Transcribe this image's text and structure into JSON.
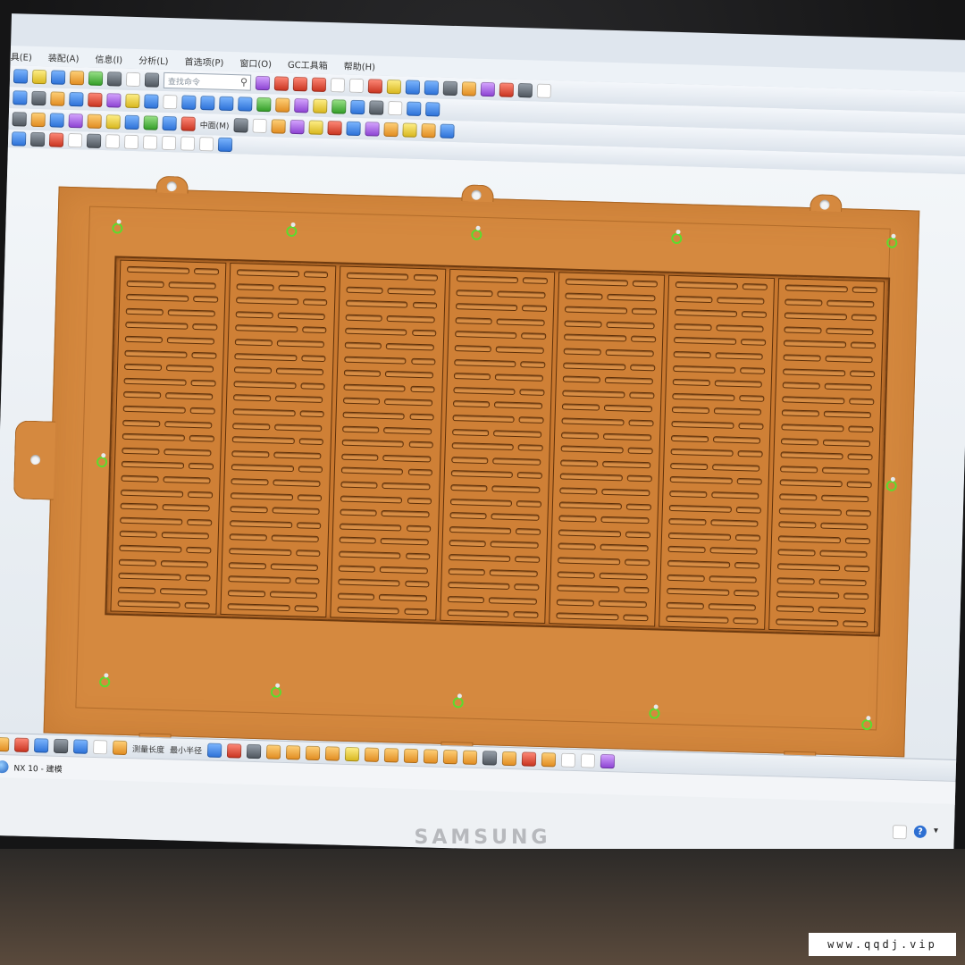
{
  "app": {
    "menu": [
      "具(E)",
      "装配(A)",
      "信息(I)",
      "分析(L)",
      "首选项(P)",
      "窗口(O)",
      "GC工具箱",
      "帮助(H)"
    ],
    "search_placeholder": "查找命令",
    "toolbar_labels": [
      "中面(M)"
    ],
    "bottom_toolbar_labels": [
      "测量长度",
      "最小半径"
    ],
    "status_task": "NX 10 - 建模",
    "monitor_brand": "SAMSUNG",
    "watermark": "www.qqdj.vip"
  },
  "colors": {
    "part_orange": "#d5893f",
    "part_edge": "#a96523",
    "viewport_bg": "#e9eef3",
    "marker_green": "#5bdc2e",
    "accent_blue": "#2d6fd2"
  },
  "icons": {
    "search": "search-icon",
    "help": "help-icon",
    "refresh": "refresh-icon",
    "clock": "clock-icon",
    "globe": "globe-icon"
  },
  "part": {
    "slot_panels": 7,
    "slot_rows": 25
  }
}
